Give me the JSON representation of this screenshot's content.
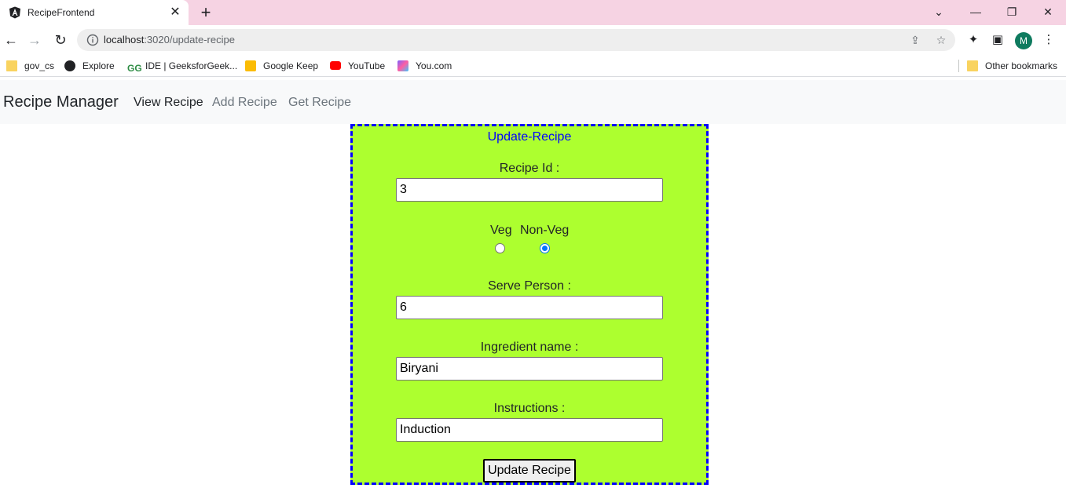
{
  "browser": {
    "tab_title": "RecipeFrontend",
    "url_host": "localhost",
    "url_rest": ":3020/update-recipe",
    "avatar_letter": "M",
    "bookmarks": [
      {
        "label": "gov_cs",
        "icon": "folder-icon"
      },
      {
        "label": "Explore",
        "icon": "explore-icon"
      },
      {
        "label": "IDE | GeeksforGeek...",
        "icon": "gfg-icon"
      },
      {
        "label": "Google Keep",
        "icon": "keep-icon"
      },
      {
        "label": "YouTube",
        "icon": "youtube-icon"
      },
      {
        "label": "You.com",
        "icon": "youcom-icon"
      }
    ],
    "other_bookmarks": "Other bookmarks"
  },
  "navbar": {
    "brand": "Recipe Manager",
    "links": [
      {
        "label": "View Recipe",
        "active": true
      },
      {
        "label": "Add Recipe",
        "active": false
      },
      {
        "label": "Get Recipe",
        "active": false
      }
    ]
  },
  "form": {
    "title": "Update-Recipe",
    "recipe_id_label": "Recipe Id :",
    "recipe_id_value": "3",
    "veg_label": "Veg",
    "nonveg_label": "Non-Veg",
    "selected_type": "Non-Veg",
    "serve_label": "Serve Person :",
    "serve_value": "6",
    "ingredient_label": "Ingredient name :",
    "ingredient_value": "Biryani",
    "instructions_label": "Instructions :",
    "instructions_value": "Induction",
    "submit_label": "Update Recipe"
  },
  "colors": {
    "form_bg": "#adff2f",
    "form_border": "#0000ff",
    "title_color": "#0000ff",
    "tabstrip_bg": "#f6d3e3"
  }
}
